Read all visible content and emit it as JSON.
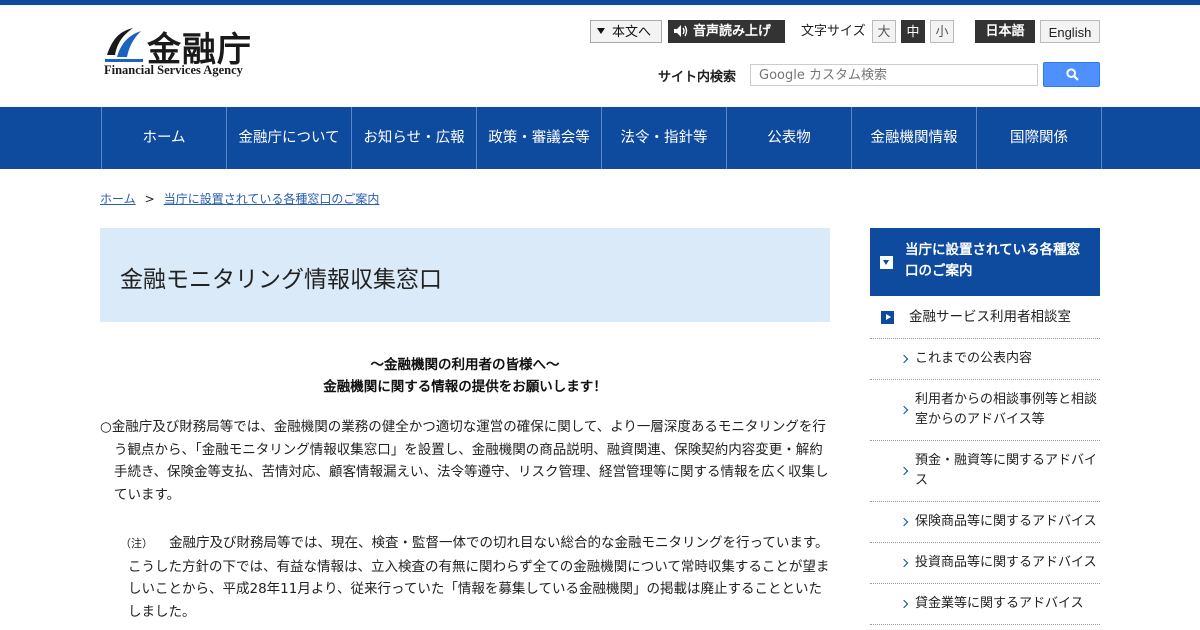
{
  "header": {
    "logo_jp": "金融庁",
    "logo_en": "Financial Services Agency",
    "skip_label": "本文へ",
    "voice_label": "音声読み上げ",
    "font_size_label": "文字サイズ",
    "font_sizes": [
      "大",
      "中",
      "小"
    ],
    "font_size_selected": "中",
    "lang_ja": "日本語",
    "lang_en": "English",
    "search_label": "サイト内検索",
    "search_placeholder": "Google カスタム検索"
  },
  "nav": [
    "ホーム",
    "金融庁について",
    "お知らせ・広報",
    "政策・審議会等",
    "法令・指針等",
    "公表物",
    "金融機関情報",
    "国際関係"
  ],
  "breadcrumb": {
    "home": "ホーム",
    "separator": ">",
    "current": "当庁に設置されている各種窓口のご案内"
  },
  "main": {
    "title": "金融モニタリング情報収集窓口",
    "lead_line1": "～金融機関の利用者の皆様へ～",
    "lead_line2": "金融機関に関する情報の提供をお願いします！",
    "paragraph": "○金融庁及び財務局等では、金融機関の業務の健全かつ適切な運営の確保に関して、より一層深度あるモニタリングを行う観点から、「金融モニタリング情報収集窓口」を設置し、金融機関の商品説明、融資関連、保険契約内容変更・解約手続き、保険金等支払、苦情対応、顧客情報漏えい、法令等遵守、リスク管理、経営管理等に関する情報を広く収集しています。",
    "note_tag": "（注）",
    "note": "金融庁及び財務局等では、現在、検査・監督一体での切れ目ない総合的な金融モニタリングを行っています。こうした方針の下では、有益な情報は、立入検査の有無に関わらず全ての金融機関について常時収集することが望ましいことから、平成28年11月より、従来行っていた「情報を募集している金融機関」の掲載は廃止することといたしました。"
  },
  "sidebar": {
    "heading": "当庁に設置されている各種窓口のご案内",
    "sub_heading": "金融サービス利用者相談室",
    "items": [
      "これまでの公表内容",
      "利用者からの相談事例等と相談室からのアドバイス等",
      "預金・融資等に関するアドバイス",
      "保険商品等に関するアドバイス",
      "投資商品等に関するアドバイス",
      "貸金業等に関するアドバイス"
    ]
  },
  "colors": {
    "brand_blue": "#0e4a9e",
    "title_bg": "#daeaf8",
    "search_button": "#4d90fe"
  }
}
